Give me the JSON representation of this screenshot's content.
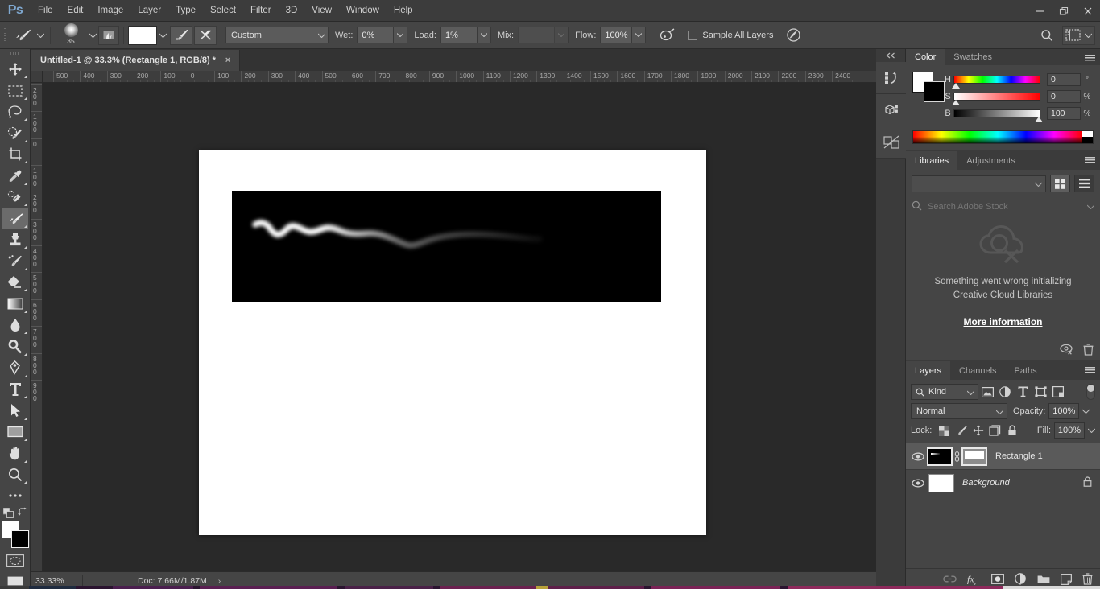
{
  "app": {
    "name": "Adobe Photoshop",
    "logo": "Ps"
  },
  "menubar": {
    "items": [
      "File",
      "Edit",
      "Image",
      "Layer",
      "Type",
      "Select",
      "Filter",
      "3D",
      "View",
      "Window",
      "Help"
    ]
  },
  "window_controls": {
    "minimize": "minimize-icon",
    "restore": "restore-icon",
    "close": "close-icon"
  },
  "options_bar": {
    "tool": "mixer-brush-tool",
    "brush_size": "35",
    "preset_label": "Custom",
    "wet_label": "Wet:",
    "wet_value": "0%",
    "load_label": "Load:",
    "load_value": "1%",
    "mix_label": "Mix:",
    "mix_value": "",
    "flow_label": "Flow:",
    "flow_value": "100%",
    "sample_all_layers": "Sample All Layers",
    "search_icon": "search-icon",
    "workspace_icon": "workspace-icon"
  },
  "toolbar": {
    "tools": [
      {
        "name": "move-tool",
        "active": false
      },
      {
        "name": "rectangular-marquee-tool",
        "active": false
      },
      {
        "name": "lasso-tool",
        "active": false
      },
      {
        "name": "quick-selection-tool",
        "active": false
      },
      {
        "name": "crop-tool",
        "active": false
      },
      {
        "name": "eyedropper-tool",
        "active": false
      },
      {
        "name": "spot-healing-brush-tool",
        "active": false
      },
      {
        "name": "mixer-brush-tool",
        "active": true
      },
      {
        "name": "clone-stamp-tool",
        "active": false
      },
      {
        "name": "history-brush-tool",
        "active": false
      },
      {
        "name": "eraser-tool",
        "active": false
      },
      {
        "name": "gradient-tool",
        "active": false
      },
      {
        "name": "blur-tool",
        "active": false
      },
      {
        "name": "dodge-tool",
        "active": false
      },
      {
        "name": "pen-tool",
        "active": false
      },
      {
        "name": "type-tool",
        "active": false
      },
      {
        "name": "path-selection-tool",
        "active": false
      },
      {
        "name": "rectangle-tool",
        "active": false
      },
      {
        "name": "hand-tool",
        "active": false
      },
      {
        "name": "zoom-tool",
        "active": false
      },
      {
        "name": "more-tools",
        "active": false
      }
    ],
    "foreground_color": "#ffffff",
    "background_color": "#000000",
    "quick_mask": "quick-mask-icon"
  },
  "document": {
    "tab_title": "Untitled-1 @ 33.3% (Rectangle 1, RGB/8) *",
    "close_label": "×",
    "ruler_h_labels": [
      "500",
      "400",
      "300",
      "200",
      "100",
      "0",
      "100",
      "200",
      "300",
      "400",
      "500",
      "600",
      "700",
      "800",
      "900",
      "1000",
      "1100",
      "1200",
      "1300",
      "1400",
      "1500",
      "1600",
      "1700",
      "1800",
      "1900",
      "2000",
      "2100",
      "2200",
      "2300",
      "2400"
    ],
    "ruler_v_labels": [
      "200",
      "100",
      "0",
      "100",
      "200",
      "300",
      "400",
      "500",
      "600",
      "700",
      "800",
      "900"
    ]
  },
  "status_bar": {
    "zoom": "33.33%",
    "doc_label": "Doc: 7.66M/1.87M",
    "arrow": "›"
  },
  "dock_rail": {
    "collapse_icon": "collapse-panels-icon",
    "buttons": [
      "history-panel-icon",
      "3d-panel-icon",
      "properties-panel-icon"
    ]
  },
  "color_panel": {
    "tabs": [
      {
        "label": "Color",
        "active": true
      },
      {
        "label": "Swatches",
        "active": false
      }
    ],
    "menu_icon": "panel-menu-icon",
    "foreground": "#ffffff",
    "background": "#000000",
    "sliders": [
      {
        "label": "H",
        "value": "0",
        "unit": "°",
        "pos": 2
      },
      {
        "label": "S",
        "value": "0",
        "unit": "%",
        "pos": 2
      },
      {
        "label": "B",
        "value": "100",
        "unit": "%",
        "pos": 100
      }
    ]
  },
  "libraries_panel": {
    "tabs": [
      {
        "label": "Libraries",
        "active": true
      },
      {
        "label": "Adjustments",
        "active": false
      }
    ],
    "menu_icon": "panel-menu-icon",
    "library_select_value": "",
    "search_placeholder": "Search Adobe Stock",
    "error_line1": "Something went wrong initializing",
    "error_line2": "Creative Cloud Libraries",
    "more_info": "More information",
    "footer_icons": [
      "sync-error-icon",
      "delete-icon"
    ]
  },
  "layers_panel": {
    "tabs": [
      {
        "label": "Layers",
        "active": true
      },
      {
        "label": "Channels",
        "active": false
      },
      {
        "label": "Paths",
        "active": false
      }
    ],
    "menu_icon": "panel-menu-icon",
    "kind_label": "Kind",
    "filter_icons": [
      "filter-pixel-icon",
      "filter-adjustment-icon",
      "filter-type-icon",
      "filter-shape-icon",
      "filter-smart-icon"
    ],
    "blend_mode": "Normal",
    "opacity_label": "Opacity:",
    "opacity_value": "100%",
    "lock_label": "Lock:",
    "lock_icons": [
      "lock-transparent-pixels-icon",
      "lock-image-pixels-icon",
      "lock-position-icon",
      "lock-artboard-icon",
      "lock-all-icon"
    ],
    "fill_label": "Fill:",
    "fill_value": "100%",
    "layers": [
      {
        "name": "Rectangle 1",
        "selected": true,
        "visible": true,
        "locked": false,
        "italic": false
      },
      {
        "name": "Background",
        "selected": false,
        "visible": true,
        "locked": true,
        "italic": true
      }
    ],
    "footer_icons": [
      "link-layers-icon",
      "layer-style-fx-icon",
      "add-mask-icon",
      "adjustment-layer-icon",
      "new-group-icon",
      "new-layer-icon",
      "delete-layer-icon"
    ]
  },
  "canvas": {
    "page_background": "#ffffff",
    "rectangle_color": "#000000",
    "stroke_description": "white-brush-stroke",
    "stroke_color": "#ffffff"
  }
}
